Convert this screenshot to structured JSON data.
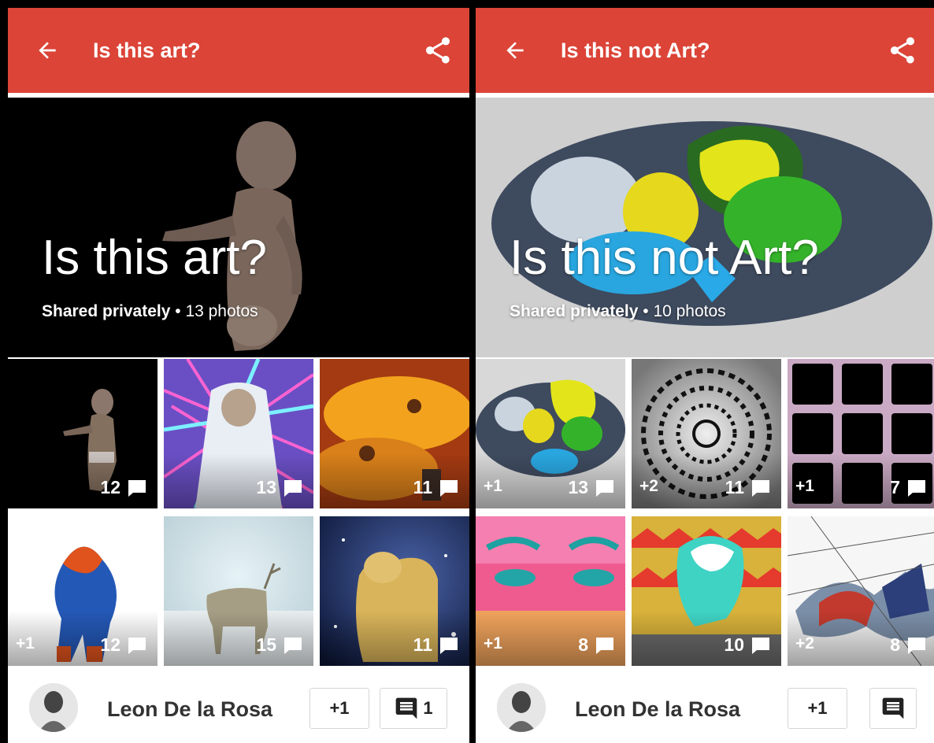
{
  "colors": {
    "appbar": "#db4437",
    "text_on_image": "#ffffff",
    "button_border": "#d6d6d6"
  },
  "panels": [
    {
      "appbar": {
        "back_icon": "arrow-back-icon",
        "title": "Is this art?",
        "share_icon": "share-icon"
      },
      "cover": {
        "title": "Is this art?",
        "shared_label": "Shared privately",
        "separator": " • ",
        "photos_label": "13 photos"
      },
      "photos": [
        {
          "plus": "",
          "comments": "12"
        },
        {
          "plus": "",
          "comments": "13"
        },
        {
          "plus": "",
          "comments": "11"
        },
        {
          "plus": "+1",
          "comments": "12"
        },
        {
          "plus": "",
          "comments": "15"
        },
        {
          "plus": "",
          "comments": "11"
        }
      ],
      "footer": {
        "author": "Leon De la Rosa",
        "plus_one": "+1",
        "comment_icon": "comment-icon",
        "comment_count": "1"
      }
    },
    {
      "appbar": {
        "back_icon": "arrow-back-icon",
        "title": "Is this not Art?",
        "share_icon": "share-icon"
      },
      "cover": {
        "title": "Is this not Art?",
        "shared_label": "Shared privately",
        "separator": " • ",
        "photos_label": "10 photos"
      },
      "photos": [
        {
          "plus": "+1",
          "comments": "13"
        },
        {
          "plus": "+2",
          "comments": "11"
        },
        {
          "plus": "+1",
          "comments": "7"
        },
        {
          "plus": "+1",
          "comments": "8"
        },
        {
          "plus": "",
          "comments": "10"
        },
        {
          "plus": "+2",
          "comments": "8"
        }
      ],
      "footer": {
        "author": "Leon De la Rosa",
        "plus_one": "+1",
        "comment_icon": "comment-icon",
        "comment_count": ""
      }
    }
  ]
}
